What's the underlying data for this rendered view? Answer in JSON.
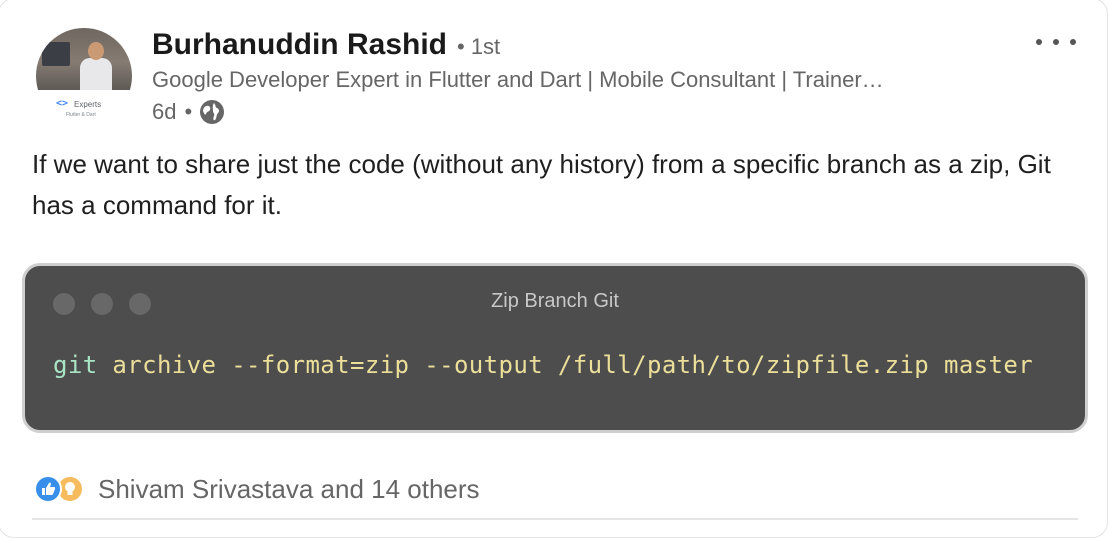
{
  "post": {
    "author": {
      "name": "Burhanuddin Rashid",
      "degree": "• 1st",
      "headline": "Google Developer Expert in Flutter and Dart | Mobile Consultant | Trainer…",
      "avatar_badge": {
        "mark": "<>",
        "title": "Experts",
        "subtitle": "Flutter & Dart"
      }
    },
    "meta": {
      "age": "6d",
      "separator": "•",
      "visibility_icon": "globe-icon"
    },
    "more_icon": "more-horizontal-icon",
    "text": "If we want to share just the code (without any history) from a specific branch as a zip, Git has a command for it.",
    "code_snippet": {
      "window_title": "Zip Branch Git",
      "command": "git",
      "arguments": " archive --format=zip --output /full/path/to/zipfile.zip master",
      "colors": {
        "background": "#4d4d4d",
        "command": "#a9e5c4",
        "arguments": "#ecdf9a"
      }
    },
    "reactions": {
      "icons": [
        "like-icon",
        "insight-icon"
      ],
      "summary": "Shivam Srivastava and 14 others"
    }
  }
}
